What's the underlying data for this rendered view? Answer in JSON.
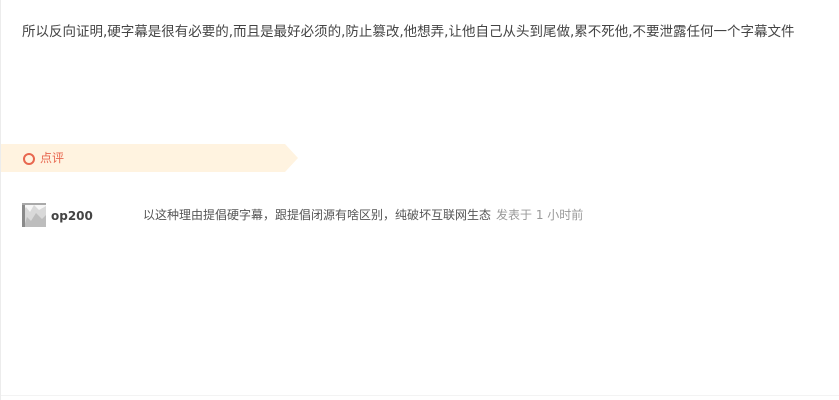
{
  "post": {
    "body_text": "所以反向证明,硬字幕是很有必要的,而且是最好必须的,防止篡改,他想弄,让他自己从头到尾做,累不死他,不要泄露任何一个字幕文件"
  },
  "rate_section": {
    "title": "点评",
    "icon": "circle-icon",
    "accent_color": "#e8674f",
    "banner_color": "#fff3e0"
  },
  "comments": [
    {
      "avatar_icon": "avatar-image",
      "username": "op200",
      "text": "以这种理由提倡硬字幕，跟提倡闭源有啥区别，纯破坏互联网生态",
      "time": "发表于 1 小时前"
    }
  ]
}
